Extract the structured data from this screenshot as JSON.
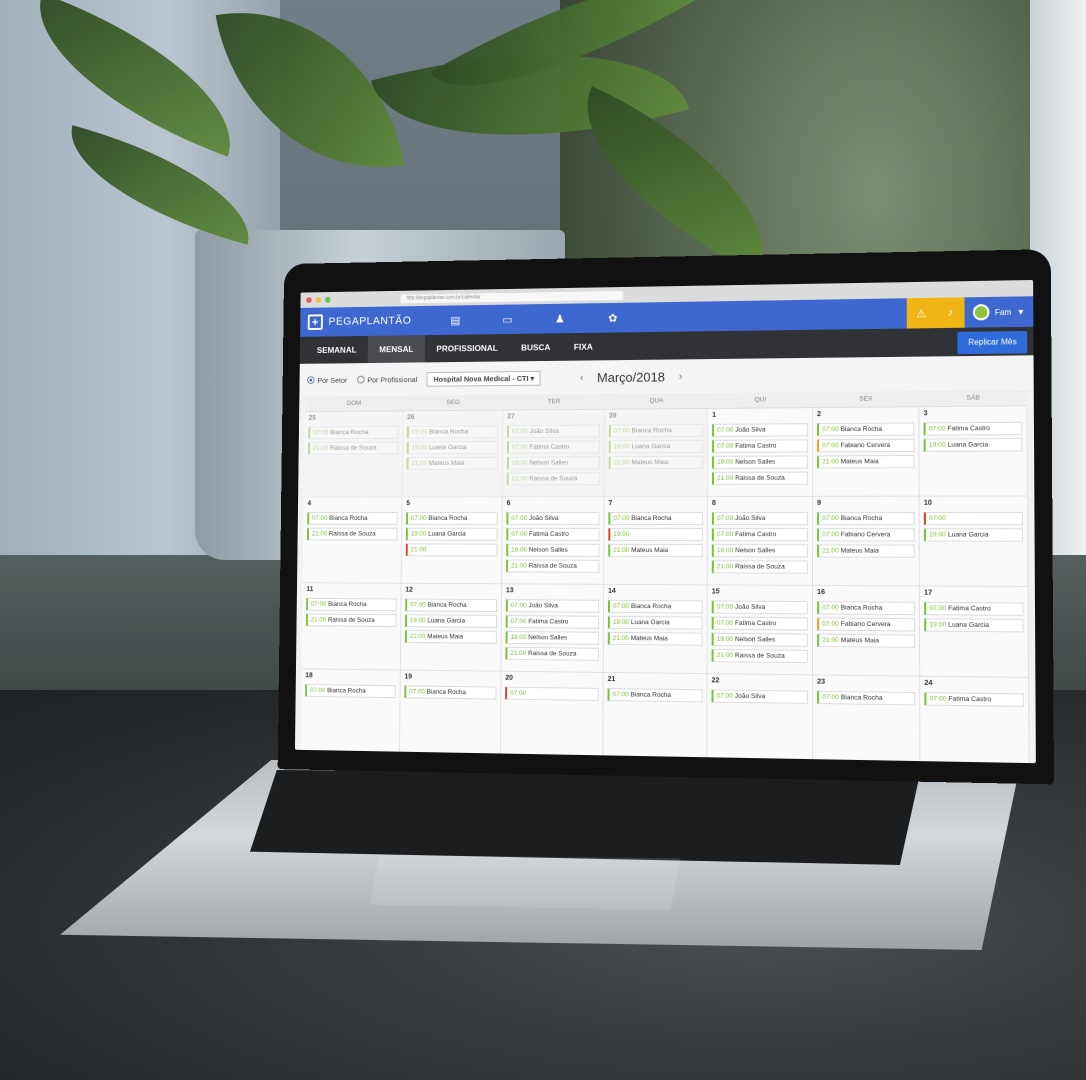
{
  "browser": {
    "url": "http://pegaplantao.com.br/calendar"
  },
  "app": {
    "brand": "PEGAPLANTÃO",
    "nav_icons": [
      "chart-icon",
      "calendar-icon",
      "person-icon",
      "gear-icon"
    ],
    "notifications": [
      "bell-icon",
      "bell-icon"
    ],
    "user": "Fam"
  },
  "tabs": [
    "SEMANAL",
    "MENSAL",
    "PROFISSIONAL",
    "BUSCA",
    "FIXA"
  ],
  "active_tab": "MENSAL",
  "replicate_button": "Replicar Mês",
  "filters": {
    "radio_setor": "Por Setor",
    "radio_profissional": "Por Profissional",
    "hospital": "Hospital Nova Medical - CTI"
  },
  "month": {
    "label": "Março/2018",
    "prev": "‹",
    "next": "›"
  },
  "weekdays": [
    "DOM",
    "SEG",
    "TER",
    "QUA",
    "QUI",
    "SEX",
    "SÁB"
  ],
  "days": [
    {
      "num": "25",
      "past": true,
      "shifts": [
        [
          "07:00",
          "Bianca Rocha",
          "g"
        ],
        [
          "21:00",
          "Raissa de Souza",
          "g"
        ]
      ]
    },
    {
      "num": "26",
      "past": true,
      "shifts": [
        [
          "07:00",
          "Bianca Rocha",
          "g"
        ],
        [
          "19:00",
          "Luana Garcia",
          "g"
        ],
        [
          "21:00",
          "Mateus Maia",
          "g"
        ]
      ]
    },
    {
      "num": "27",
      "past": true,
      "shifts": [
        [
          "07:00",
          "João Silva",
          "g"
        ],
        [
          "07:00",
          "Fatima Castro",
          "g"
        ],
        [
          "19:00",
          "Nelson Salles",
          "g"
        ],
        [
          "21:00",
          "Raissa de Souza",
          "g"
        ]
      ]
    },
    {
      "num": "28",
      "past": true,
      "shifts": [
        [
          "07:00",
          "Bianca Rocha",
          "g"
        ],
        [
          "19:00",
          "Luana Garcia",
          "g"
        ],
        [
          "21:00",
          "Mateus Maia",
          "g"
        ]
      ]
    },
    {
      "num": "1",
      "past": false,
      "shifts": [
        [
          "07:00",
          "João Silva",
          "g"
        ],
        [
          "07:00",
          "Fatima Castro",
          "g"
        ],
        [
          "19:00",
          "Nelson Salles",
          "g"
        ],
        [
          "21:00",
          "Raissa de Souza",
          "g"
        ]
      ]
    },
    {
      "num": "2",
      "past": false,
      "shifts": [
        [
          "07:00",
          "Bianca Rocha",
          "g"
        ],
        [
          "07:00",
          "Fabiano Cervera",
          "o"
        ],
        [
          "21:00",
          "Mateus Maia",
          "g"
        ]
      ]
    },
    {
      "num": "3",
      "past": false,
      "shifts": [
        [
          "07:00",
          "Fatima Castro",
          "g"
        ],
        [
          "19:00",
          "Luana Garcia",
          "g"
        ]
      ]
    },
    {
      "num": "4",
      "past": false,
      "shifts": [
        [
          "07:00",
          "Bianca Rocha",
          "g"
        ],
        [
          "21:00",
          "Raissa de Souza",
          "g"
        ]
      ]
    },
    {
      "num": "5",
      "past": false,
      "shifts": [
        [
          "07:00",
          "Bianca Rocha",
          "g"
        ],
        [
          "19:00",
          "Luana Garcia",
          "g"
        ],
        [
          "21:00",
          "",
          "r"
        ]
      ]
    },
    {
      "num": "6",
      "past": false,
      "shifts": [
        [
          "07:00",
          "João Silva",
          "g"
        ],
        [
          "07:00",
          "Fatima Castro",
          "g"
        ],
        [
          "19:00",
          "Nelson Salles",
          "g"
        ],
        [
          "21:00",
          "Raissa de Souza",
          "g"
        ]
      ]
    },
    {
      "num": "7",
      "past": false,
      "shifts": [
        [
          "07:00",
          "Bianca Rocha",
          "g"
        ],
        [
          "19:00",
          "",
          "r"
        ],
        [
          "21:00",
          "Mateus Maia",
          "g"
        ]
      ]
    },
    {
      "num": "8",
      "past": false,
      "shifts": [
        [
          "07:00",
          "João Silva",
          "g"
        ],
        [
          "07:00",
          "Fatima Castro",
          "g"
        ],
        [
          "19:00",
          "Nelson Salles",
          "g"
        ],
        [
          "21:00",
          "Raissa de Souza",
          "g"
        ]
      ]
    },
    {
      "num": "9",
      "past": false,
      "shifts": [
        [
          "07:00",
          "Bianca Rocha",
          "g"
        ],
        [
          "07:00",
          "Fabiano Cervera",
          "g"
        ],
        [
          "21:00",
          "Mateus Maia",
          "g"
        ]
      ]
    },
    {
      "num": "10",
      "past": false,
      "shifts": [
        [
          "07:00",
          "",
          "r"
        ],
        [
          "19:00",
          "Luana Garcia",
          "g"
        ]
      ]
    },
    {
      "num": "11",
      "past": false,
      "shifts": [
        [
          "07:00",
          "Bianca Rocha",
          "g"
        ],
        [
          "21:00",
          "Raissa de Souza",
          "g"
        ]
      ]
    },
    {
      "num": "12",
      "past": false,
      "shifts": [
        [
          "07:00",
          "Bianca Rocha",
          "g"
        ],
        [
          "19:00",
          "Luana Garcia",
          "g"
        ],
        [
          "21:00",
          "Mateus Maia",
          "g"
        ]
      ]
    },
    {
      "num": "13",
      "past": false,
      "shifts": [
        [
          "07:00",
          "João Silva",
          "g"
        ],
        [
          "07:00",
          "Fatima Castro",
          "g"
        ],
        [
          "19:00",
          "Nelson Salles",
          "g"
        ],
        [
          "21:00",
          "Raissa de Souza",
          "g"
        ]
      ]
    },
    {
      "num": "14",
      "past": false,
      "shifts": [
        [
          "07:00",
          "Bianca Rocha",
          "g"
        ],
        [
          "19:00",
          "Luana Garcia",
          "g"
        ],
        [
          "21:00",
          "Mateus Maia",
          "g"
        ]
      ]
    },
    {
      "num": "15",
      "past": false,
      "shifts": [
        [
          "07:00",
          "João Silva",
          "g"
        ],
        [
          "07:00",
          "Fatima Castro",
          "g"
        ],
        [
          "19:00",
          "Nelson Salles",
          "g"
        ],
        [
          "21:00",
          "Raissa de Souza",
          "g"
        ]
      ]
    },
    {
      "num": "16",
      "past": false,
      "shifts": [
        [
          "07:00",
          "Bianca Rocha",
          "g"
        ],
        [
          "07:00",
          "Fabiano Cervera",
          "o"
        ],
        [
          "21:00",
          "Mateus Maia",
          "g"
        ]
      ]
    },
    {
      "num": "17",
      "past": false,
      "shifts": [
        [
          "07:00",
          "Fatima Castro",
          "g"
        ],
        [
          "19:00",
          "Luana Garcia",
          "g"
        ]
      ]
    },
    {
      "num": "18",
      "past": false,
      "shifts": [
        [
          "07:00",
          "Bianca Rocha",
          "g"
        ]
      ]
    },
    {
      "num": "19",
      "past": false,
      "shifts": [
        [
          "07:00",
          "Bianca Rocha",
          "g"
        ]
      ]
    },
    {
      "num": "20",
      "past": false,
      "shifts": [
        [
          "07:00",
          "",
          "r"
        ]
      ]
    },
    {
      "num": "21",
      "past": false,
      "shifts": [
        [
          "07:00",
          "Bianca Rocha",
          "g"
        ]
      ]
    },
    {
      "num": "22",
      "past": false,
      "shifts": [
        [
          "07:00",
          "João Silva",
          "g"
        ]
      ]
    },
    {
      "num": "23",
      "past": false,
      "shifts": [
        [
          "07:00",
          "Bianca Rocha",
          "g"
        ]
      ]
    },
    {
      "num": "24",
      "past": false,
      "shifts": [
        [
          "07:00",
          "Fatima Castro",
          "g"
        ]
      ]
    }
  ],
  "colors": {
    "topbar": "#3c68cf",
    "accent_green": "#7cc13a",
    "accent_orange": "#f0a020",
    "accent_red": "#d9412f",
    "notification": "#f0b515",
    "replicate": "#2f6bd9"
  }
}
